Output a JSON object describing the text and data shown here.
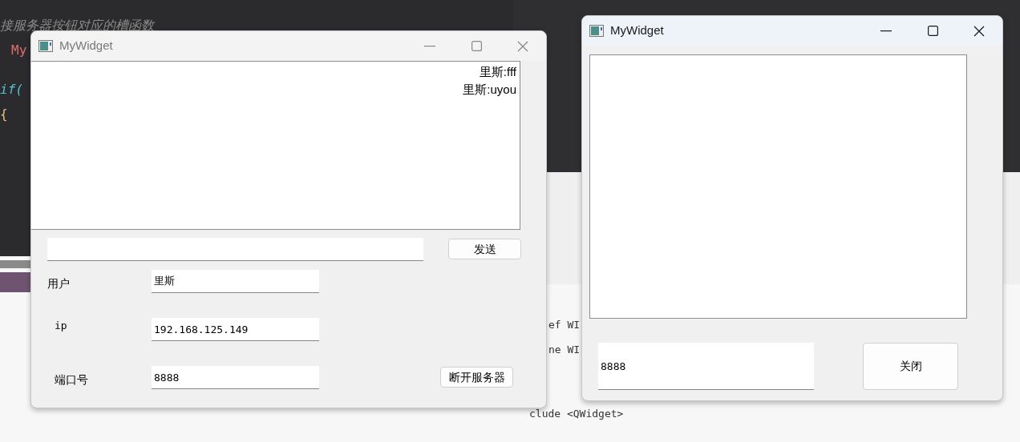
{
  "editor_left": {
    "lines": [
      {
        "text": "接服务器按钮对应的槽函数",
        "kind": "comment"
      },
      {
        "text": "My",
        "kind": "identifier"
      },
      {
        "text": "if(",
        "kind": "keyword"
      },
      {
        "text": "{",
        "kind": "brace"
      }
    ]
  },
  "editor_right": {
    "lines": [
      {
        "text": "ef WI"
      },
      {
        "text": "ne WI"
      },
      {
        "text": "clude <QWidget>"
      }
    ]
  },
  "windows": [
    {
      "title": "MyWidget",
      "active": false,
      "messages": [
        "里斯:fff",
        "里斯:uyou"
      ],
      "send_button": "发送",
      "fields": [
        {
          "label": "用户",
          "value": "里斯"
        },
        {
          "label": "ip",
          "value": "192.168.125.149"
        },
        {
          "label": "端口号",
          "value": "8888"
        }
      ],
      "disconnect_button": "断开服务器"
    },
    {
      "title": "MyWidget",
      "active": true,
      "port_value": "8888",
      "close_button": "关闭"
    }
  ]
}
